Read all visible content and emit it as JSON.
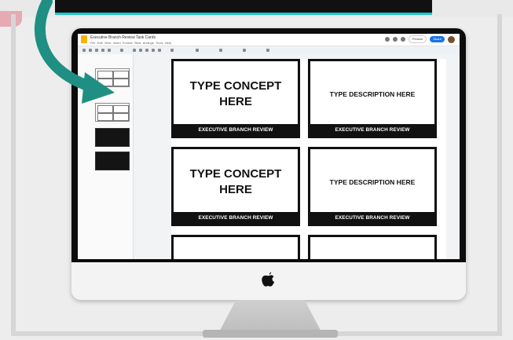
{
  "app": {
    "doc_title": "Executive Branch Review Task Cards",
    "menu": [
      "File",
      "Edit",
      "View",
      "Insert",
      "Format",
      "Slide",
      "Arrange",
      "Tools",
      "Help"
    ],
    "present_label": "Present",
    "share_label": "Share"
  },
  "cards": [
    {
      "text": "TYPE CONCEPT HERE",
      "footer": "EXECUTIVE BRANCH REVIEW"
    },
    {
      "text": "TYPE DESCRIPTION HERE",
      "footer": "EXECUTIVE BRANCH REVIEW"
    },
    {
      "text": "TYPE CONCEPT HERE",
      "footer": "EXECUTIVE BRANCH REVIEW"
    },
    {
      "text": "TYPE DESCRIPTION HERE",
      "footer": "EXECUTIVE BRANCH REVIEW"
    }
  ],
  "colors": {
    "arrow": "#1f8f83",
    "accent_teal": "#1bc7c9",
    "card_border": "#111111",
    "share_button": "#1a73e8"
  },
  "icons": [
    "apple-logo",
    "curved-arrow"
  ]
}
